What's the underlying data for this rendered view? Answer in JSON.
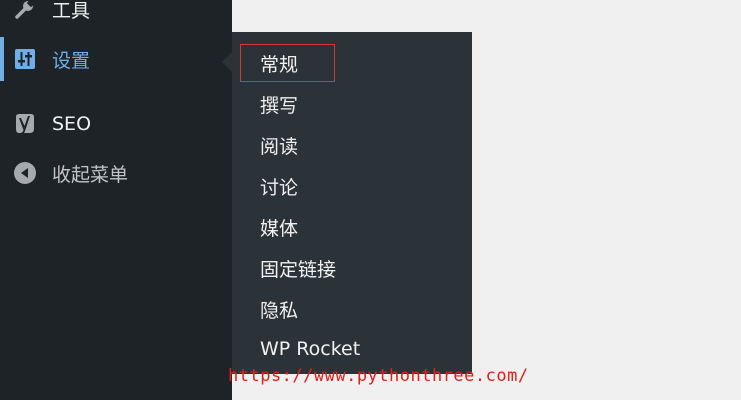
{
  "sidebar": {
    "items": [
      {
        "label": "工具",
        "icon": "wrench-icon"
      },
      {
        "label": "设置",
        "icon": "settings-sliders-icon",
        "current": true
      },
      {
        "label": "SEO",
        "icon": "yoast-seo-icon"
      },
      {
        "label": "收起菜单",
        "icon": "collapse-arrow-icon"
      }
    ]
  },
  "submenu": {
    "items": [
      {
        "label": "常规",
        "highlighted": true
      },
      {
        "label": "撰写"
      },
      {
        "label": "阅读"
      },
      {
        "label": "讨论"
      },
      {
        "label": "媒体"
      },
      {
        "label": "固定链接"
      },
      {
        "label": "隐私"
      },
      {
        "label": "WP Rocket"
      }
    ]
  },
  "watermark": {
    "text": "https://www.pythonthree.com/"
  },
  "colors": {
    "sidebar_bg": "#1d2327",
    "flyout_bg": "#2c3338",
    "accent": "#72aee6",
    "highlight_border": "#d63638",
    "watermark": "#e0201a"
  }
}
